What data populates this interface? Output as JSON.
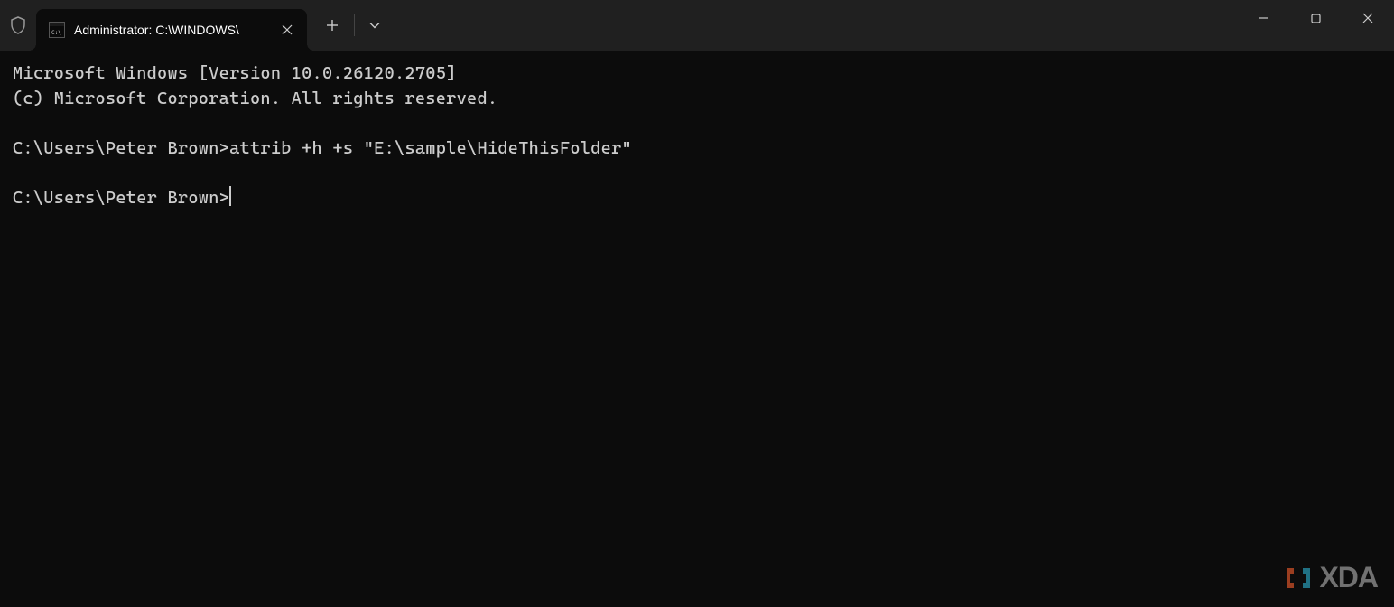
{
  "tab": {
    "title": "Administrator: C:\\WINDOWS\\"
  },
  "terminal": {
    "line1": "Microsoft Windows [Version 10.0.26120.2705]",
    "line2": "(c) Microsoft Corporation. All rights reserved.",
    "line3": "",
    "line4": "C:\\Users\\Peter Brown>attrib +h +s \"E:\\sample\\HideThisFolder\"",
    "line5": "",
    "line6_prompt": "C:\\Users\\Peter Brown>"
  },
  "watermark": {
    "text": "XDA"
  }
}
